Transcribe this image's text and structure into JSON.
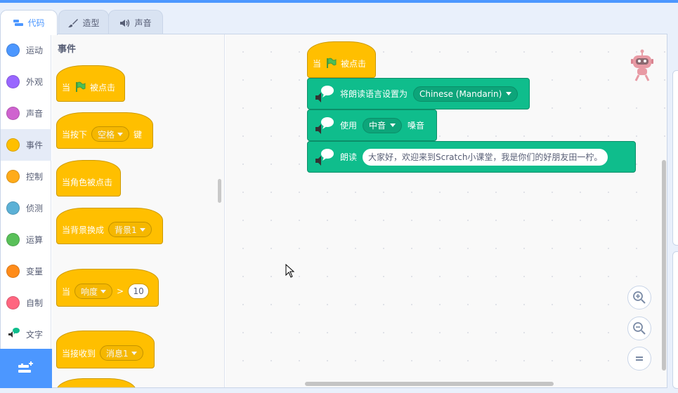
{
  "tabs": [
    {
      "label": "代码",
      "icon": "code-icon",
      "active": true
    },
    {
      "label": "造型",
      "icon": "brush-icon",
      "active": false
    },
    {
      "label": "声音",
      "icon": "speaker-icon",
      "active": false
    }
  ],
  "categories": [
    {
      "label": "运动",
      "color": "#4c97ff"
    },
    {
      "label": "外观",
      "color": "#9966ff"
    },
    {
      "label": "声音",
      "color": "#cf63cf"
    },
    {
      "label": "事件",
      "color": "#ffbf00",
      "active": true
    },
    {
      "label": "控制",
      "color": "#ffab19"
    },
    {
      "label": "侦测",
      "color": "#5cb1d6"
    },
    {
      "label": "运算",
      "color": "#59c059"
    },
    {
      "label": "变量",
      "color": "#ff8c1a"
    },
    {
      "label": "自制",
      "color": "#ff6680"
    },
    {
      "label": "文字",
      "icon": "text-to-speech-icon"
    }
  ],
  "palette": {
    "title": "事件",
    "blocks": {
      "flag_clicked": {
        "prefix": "当",
        "suffix": "被点击"
      },
      "key_pressed": {
        "prefix": "当按下",
        "dropdown": "空格",
        "suffix": "键"
      },
      "sprite_clicked": {
        "label": "当角色被点击"
      },
      "backdrop_switch": {
        "prefix": "当背景换成",
        "dropdown": "背景1"
      },
      "greater_than": {
        "prefix": "当",
        "dropdown": "响度",
        "operator": ">",
        "value": "10"
      },
      "receive": {
        "prefix": "当接收到",
        "dropdown": "消息1"
      }
    }
  },
  "script": {
    "hat": {
      "prefix": "当",
      "suffix": "被点击"
    },
    "set_language": {
      "label": "将朗读语言设置为",
      "value": "Chinese (Mandarin)"
    },
    "set_voice": {
      "prefix": "使用",
      "value": "中音",
      "suffix": "嗓音"
    },
    "speak": {
      "label": "朗读",
      "text": "大家好，欢迎来到Scratch小课堂，我是你们的好朋友田一柠。"
    }
  },
  "colors": {
    "events": "#ffbf00",
    "text_to_speech": "#0fbd8c",
    "accent": "#4c97ff"
  }
}
